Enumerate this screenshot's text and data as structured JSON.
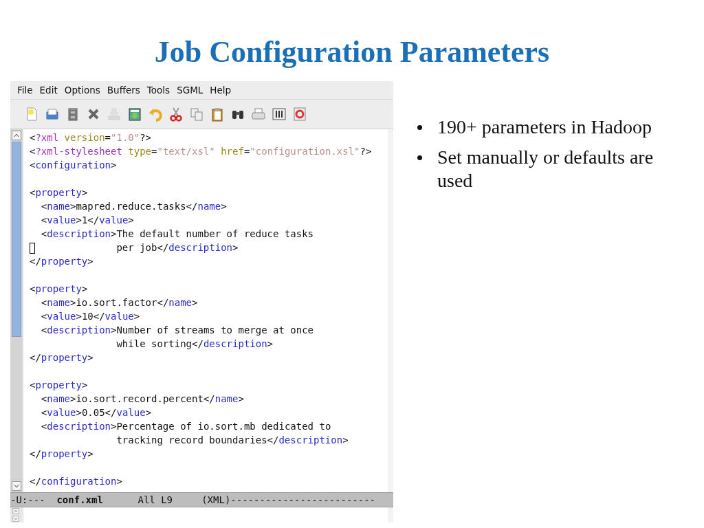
{
  "slide": {
    "title": "Job Configuration Parameters",
    "bullets": [
      "190+ parameters in Hadoop",
      "Set manually or defaults are used"
    ]
  },
  "editor": {
    "menu": [
      "File",
      "Edit",
      "Options",
      "Buffers",
      "Tools",
      "SGML",
      "Help"
    ],
    "toolbar": [
      {
        "kind": "new",
        "disabled": false
      },
      {
        "kind": "open",
        "disabled": false
      },
      {
        "kind": "cabinet",
        "disabled": false
      },
      {
        "kind": "close",
        "disabled": false
      },
      {
        "kind": "download",
        "disabled": true
      },
      {
        "kind": "save-as",
        "disabled": false
      },
      {
        "kind": "undo",
        "disabled": false
      },
      {
        "kind": "cut",
        "disabled": false
      },
      {
        "kind": "copy",
        "disabled": false
      },
      {
        "kind": "paste",
        "disabled": false
      },
      {
        "kind": "search",
        "disabled": false
      },
      {
        "kind": "print",
        "disabled": false
      },
      {
        "kind": "preferences",
        "disabled": false
      },
      {
        "kind": "help",
        "disabled": false
      }
    ],
    "lines": [
      {
        "kind": "code",
        "cursor": false,
        "segments": [
          {
            "kind": "plain",
            "text": "<"
          },
          {
            "kind": "pi",
            "text": "?xml"
          },
          {
            "kind": "attr",
            "text": " version"
          },
          {
            "kind": "plain",
            "text": "="
          },
          {
            "kind": "string",
            "text": "\"1.0\""
          },
          {
            "kind": "plain",
            "text": "?>"
          }
        ]
      },
      {
        "kind": "code",
        "cursor": false,
        "segments": [
          {
            "kind": "plain",
            "text": "<"
          },
          {
            "kind": "pi",
            "text": "?xml-stylesheet"
          },
          {
            "kind": "attr",
            "text": " type"
          },
          {
            "kind": "plain",
            "text": "="
          },
          {
            "kind": "string",
            "text": "\"text/xsl\""
          },
          {
            "kind": "attr",
            "text": " href"
          },
          {
            "kind": "plain",
            "text": "="
          },
          {
            "kind": "string",
            "text": "\"configuration.xsl\""
          },
          {
            "kind": "plain",
            "text": "?>"
          }
        ]
      },
      {
        "kind": "code",
        "cursor": false,
        "segments": [
          {
            "kind": "plain",
            "text": "<"
          },
          {
            "kind": "tag",
            "text": "configuration"
          },
          {
            "kind": "plain",
            "text": ">"
          }
        ]
      },
      {
        "kind": "blank"
      },
      {
        "kind": "code",
        "cursor": false,
        "segments": [
          {
            "kind": "plain",
            "text": "<"
          },
          {
            "kind": "tag",
            "text": "property"
          },
          {
            "kind": "plain",
            "text": ">"
          }
        ]
      },
      {
        "kind": "code",
        "cursor": false,
        "segments": [
          {
            "kind": "plain",
            "text": "  <"
          },
          {
            "kind": "tag",
            "text": "name"
          },
          {
            "kind": "plain",
            "text": ">mapred.reduce.tasks</"
          },
          {
            "kind": "tag",
            "text": "name"
          },
          {
            "kind": "plain",
            "text": ">"
          }
        ]
      },
      {
        "kind": "code",
        "cursor": false,
        "segments": [
          {
            "kind": "plain",
            "text": "  <"
          },
          {
            "kind": "tag",
            "text": "value"
          },
          {
            "kind": "plain",
            "text": ">1</"
          },
          {
            "kind": "tag",
            "text": "value"
          },
          {
            "kind": "plain",
            "text": ">"
          }
        ]
      },
      {
        "kind": "code",
        "cursor": false,
        "segments": [
          {
            "kind": "plain",
            "text": "  <"
          },
          {
            "kind": "tag",
            "text": "description"
          },
          {
            "kind": "plain",
            "text": ">The default number of reduce tasks"
          }
        ]
      },
      {
        "kind": "code",
        "cursor": true,
        "segments": [
          {
            "kind": "plain",
            "text": "               per job</"
          },
          {
            "kind": "tag",
            "text": "description"
          },
          {
            "kind": "plain",
            "text": ">"
          }
        ]
      },
      {
        "kind": "code",
        "cursor": false,
        "segments": [
          {
            "kind": "plain",
            "text": "</"
          },
          {
            "kind": "tag",
            "text": "property"
          },
          {
            "kind": "plain",
            "text": ">"
          }
        ]
      },
      {
        "kind": "blank"
      },
      {
        "kind": "code",
        "cursor": false,
        "segments": [
          {
            "kind": "plain",
            "text": "<"
          },
          {
            "kind": "tag",
            "text": "property"
          },
          {
            "kind": "plain",
            "text": ">"
          }
        ]
      },
      {
        "kind": "code",
        "cursor": false,
        "segments": [
          {
            "kind": "plain",
            "text": "  <"
          },
          {
            "kind": "tag",
            "text": "name"
          },
          {
            "kind": "plain",
            "text": ">io.sort.factor</"
          },
          {
            "kind": "tag",
            "text": "name"
          },
          {
            "kind": "plain",
            "text": ">"
          }
        ]
      },
      {
        "kind": "code",
        "cursor": false,
        "segments": [
          {
            "kind": "plain",
            "text": "  <"
          },
          {
            "kind": "tag",
            "text": "value"
          },
          {
            "kind": "plain",
            "text": ">10</"
          },
          {
            "kind": "tag",
            "text": "value"
          },
          {
            "kind": "plain",
            "text": ">"
          }
        ]
      },
      {
        "kind": "code",
        "cursor": false,
        "segments": [
          {
            "kind": "plain",
            "text": "  <"
          },
          {
            "kind": "tag",
            "text": "description"
          },
          {
            "kind": "plain",
            "text": ">Number of streams to merge at once"
          }
        ]
      },
      {
        "kind": "code",
        "cursor": false,
        "segments": [
          {
            "kind": "plain",
            "text": "               while sorting</"
          },
          {
            "kind": "tag",
            "text": "description"
          },
          {
            "kind": "plain",
            "text": ">"
          }
        ]
      },
      {
        "kind": "code",
        "cursor": false,
        "segments": [
          {
            "kind": "plain",
            "text": "</"
          },
          {
            "kind": "tag",
            "text": "property"
          },
          {
            "kind": "plain",
            "text": ">"
          }
        ]
      },
      {
        "kind": "blank"
      },
      {
        "kind": "code",
        "cursor": false,
        "segments": [
          {
            "kind": "plain",
            "text": "<"
          },
          {
            "kind": "tag",
            "text": "property"
          },
          {
            "kind": "plain",
            "text": ">"
          }
        ]
      },
      {
        "kind": "code",
        "cursor": false,
        "segments": [
          {
            "kind": "plain",
            "text": "  <"
          },
          {
            "kind": "tag",
            "text": "name"
          },
          {
            "kind": "plain",
            "text": ">io.sort.record.percent</"
          },
          {
            "kind": "tag",
            "text": "name"
          },
          {
            "kind": "plain",
            "text": ">"
          }
        ]
      },
      {
        "kind": "code",
        "cursor": false,
        "segments": [
          {
            "kind": "plain",
            "text": "  <"
          },
          {
            "kind": "tag",
            "text": "value"
          },
          {
            "kind": "plain",
            "text": ">0.05</"
          },
          {
            "kind": "tag",
            "text": "value"
          },
          {
            "kind": "plain",
            "text": ">"
          }
        ]
      },
      {
        "kind": "code",
        "cursor": false,
        "segments": [
          {
            "kind": "plain",
            "text": "  <"
          },
          {
            "kind": "tag",
            "text": "description"
          },
          {
            "kind": "plain",
            "text": ">Percentage of io.sort.mb dedicated to"
          }
        ]
      },
      {
        "kind": "code",
        "cursor": false,
        "segments": [
          {
            "kind": "plain",
            "text": "               tracking record boundaries</"
          },
          {
            "kind": "tag",
            "text": "description"
          },
          {
            "kind": "plain",
            "text": ">"
          }
        ]
      },
      {
        "kind": "code",
        "cursor": false,
        "segments": [
          {
            "kind": "plain",
            "text": "</"
          },
          {
            "kind": "tag",
            "text": "property"
          },
          {
            "kind": "plain",
            "text": ">"
          }
        ]
      },
      {
        "kind": "blank"
      },
      {
        "kind": "code",
        "cursor": false,
        "segments": [
          {
            "kind": "plain",
            "text": "</"
          },
          {
            "kind": "tag",
            "text": "configuration"
          },
          {
            "kind": "plain",
            "text": ">"
          }
        ]
      }
    ],
    "mode_line": "-U:---  **conf.xml**      All L9     (XML)-------------------------"
  }
}
